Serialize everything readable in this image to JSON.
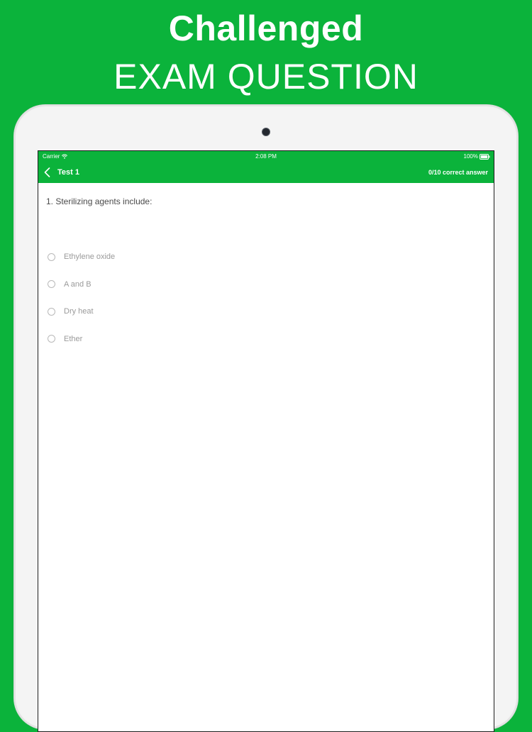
{
  "promo": {
    "title": "Challenged",
    "subtitle": "EXAM QUESTION"
  },
  "status_bar": {
    "carrier": "Carrier",
    "time": "2:08 PM",
    "battery": "100%"
  },
  "nav": {
    "back_icon": "chevron-left-icon",
    "title": "Test 1",
    "score": "0/10 correct answer"
  },
  "question": {
    "text": "1. Sterilizing agents include:",
    "options": [
      {
        "label": "Ethylene oxide",
        "selected": false
      },
      {
        "label": "A and B",
        "selected": false
      },
      {
        "label": "Dry heat",
        "selected": false
      },
      {
        "label": "Ether",
        "selected": false
      }
    ]
  },
  "colors": {
    "brand_green": "#0bb33b",
    "question_text": "#4a4a4a",
    "option_text": "#9a9a9a",
    "radio_border": "#b9b9b9"
  }
}
